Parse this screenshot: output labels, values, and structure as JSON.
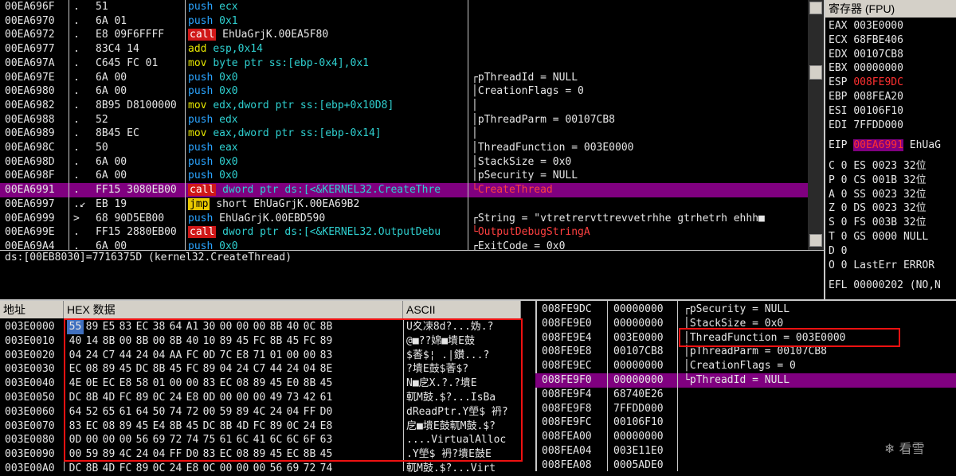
{
  "disasm": {
    "rows": [
      {
        "addr": "00EA696F",
        "mark": ".",
        "hex": "51",
        "op": "push",
        "arg": "ecx",
        "kind": "push",
        "comment": ""
      },
      {
        "addr": "00EA6970",
        "mark": ".",
        "hex": "6A 01",
        "op": "push",
        "arg": "0x1",
        "kind": "push",
        "comment": ""
      },
      {
        "addr": "00EA6972",
        "mark": ".",
        "hex": "E8 09F6FFFF",
        "op": "call",
        "arg": "EhUaGrjK.00EA5F80",
        "kind": "call",
        "comment": ""
      },
      {
        "addr": "00EA6977",
        "mark": ".",
        "hex": "83C4 14",
        "op": "add",
        "arg": "esp,0x14",
        "kind": "add",
        "comment": ""
      },
      {
        "addr": "00EA697A",
        "mark": ".",
        "hex": "C645 FC 01",
        "op": "mov",
        "arg": "byte ptr ss:[ebp-0x4],0x1",
        "kind": "mov",
        "comment": ""
      },
      {
        "addr": "00EA697E",
        "mark": ".",
        "hex": "6A 00",
        "op": "push",
        "arg": "0x0",
        "kind": "push",
        "comment": "┌pThreadId = NULL"
      },
      {
        "addr": "00EA6980",
        "mark": ".",
        "hex": "6A 00",
        "op": "push",
        "arg": "0x0",
        "kind": "push",
        "comment": "│CreationFlags = 0"
      },
      {
        "addr": "00EA6982",
        "mark": ".",
        "hex": "8B95 D8100000",
        "op": "mov",
        "arg": "edx,dword ptr ss:[ebp+0x10D8]",
        "kind": "mov",
        "comment": "│"
      },
      {
        "addr": "00EA6988",
        "mark": ".",
        "hex": "52",
        "op": "push",
        "arg": "edx",
        "kind": "push",
        "comment": "│pThreadParm = 00107CB8"
      },
      {
        "addr": "00EA6989",
        "mark": ".",
        "hex": "8B45 EC",
        "op": "mov",
        "arg": "eax,dword ptr ss:[ebp-0x14]",
        "kind": "mov",
        "comment": "│"
      },
      {
        "addr": "00EA698C",
        "mark": ".",
        "hex": "50",
        "op": "push",
        "arg": "eax",
        "kind": "push",
        "comment": "│ThreadFunction = 003E0000"
      },
      {
        "addr": "00EA698D",
        "mark": ".",
        "hex": "6A 00",
        "op": "push",
        "arg": "0x0",
        "kind": "push",
        "comment": "│StackSize = 0x0"
      },
      {
        "addr": "00EA698F",
        "mark": ".",
        "hex": "6A 00",
        "op": "push",
        "arg": "0x0",
        "kind": "push",
        "comment": "│pSecurity = NULL"
      },
      {
        "addr": "00EA6991",
        "mark": ".",
        "hex": "FF15 3080EB00",
        "op": "call",
        "arg": "dword ptr ds:[<&KERNEL32.CreateThre",
        "kind": "call",
        "comment": "└CreateThread",
        "sel": true
      },
      {
        "addr": "00EA6997",
        "mark": ".↙",
        "hex": "EB 19",
        "op": "jmp",
        "arg": "short EhUaGrjK.00EA69B2",
        "kind": "jmp",
        "comment": ""
      },
      {
        "addr": "00EA6999",
        "mark": ">",
        "hex": "68 90D5EB00",
        "op": "push",
        "arg": "EhUaGrjK.00EBD590",
        "kind": "push",
        "comment": "┌String = \"vtretrervttrevvetrhhe gtrhetrh ehhh■"
      },
      {
        "addr": "00EA699E",
        "mark": ".",
        "hex": "FF15 2880EB00",
        "op": "call",
        "arg": "dword ptr ds:[<&KERNEL32.OutputDebu",
        "kind": "call",
        "comment": "└OutputDebugStringA"
      },
      {
        "addr": "00EA69A4",
        "mark": ".",
        "hex": "6A 00",
        "op": "push",
        "arg": "0x0",
        "kind": "push",
        "comment": "┌ExitCode = 0x0"
      }
    ]
  },
  "info_line": "ds:[00EB8030]=7716375D (kernel32.CreateThread)",
  "registers": {
    "title": "寄存器 (FPU)",
    "lines": [
      {
        "name": "EAX",
        "value": "003E0000",
        "red": false
      },
      {
        "name": "ECX",
        "value": "68FBE406",
        "red": false
      },
      {
        "name": "EDX",
        "value": "00107CB8",
        "red": false
      },
      {
        "name": "EBX",
        "value": "00000000",
        "red": false
      },
      {
        "name": "ESP",
        "value": "008FE9DC",
        "red": true
      },
      {
        "name": "EBP",
        "value": "008FEA20",
        "red": false
      },
      {
        "name": "ESI",
        "value": "00106F10",
        "red": false
      },
      {
        "name": "EDI",
        "value": "7FFDD000",
        "red": false
      }
    ],
    "eip_name": "EIP",
    "eip_value": "00EA6991",
    "eip_sym": "EhUaG",
    "flags": [
      {
        "f": "C 0",
        "seg": "ES 0023",
        "bits": "32位"
      },
      {
        "f": "P 0",
        "seg": "CS 001B",
        "bits": "32位"
      },
      {
        "f": "A 0",
        "seg": "SS 0023",
        "bits": "32位"
      },
      {
        "f": "Z 0",
        "seg": "DS 0023",
        "bits": "32位"
      },
      {
        "f": "S 0",
        "seg": "FS 003B",
        "bits": "32位"
      },
      {
        "f": "T 0",
        "seg": "GS 0000",
        "bits": "NULL"
      },
      {
        "f": "D 0",
        "seg": "",
        "bits": ""
      },
      {
        "f": "O 0",
        "seg": "LastErr",
        "bits": "ERROR"
      }
    ],
    "efl": "EFL 00000202 (NO,N"
  },
  "dump": {
    "col_addr": "地址",
    "col_hex": "HEX 数据",
    "col_ascii": "ASCII",
    "rows": [
      {
        "addr": "003E0000",
        "bytes": [
          "55",
          "89",
          "E5",
          "83",
          "EC",
          "38",
          "64",
          "A1",
          "30",
          "00",
          "00",
          "00",
          "8B",
          "40",
          "0C",
          "8B"
        ],
        "ascii": "U夊凁8d?...妫.?"
      },
      {
        "addr": "003E0010",
        "bytes": [
          "40",
          "14",
          "8B",
          "00",
          "8B",
          "00",
          "8B",
          "40",
          "10",
          "89",
          "45",
          "FC",
          "8B",
          "45",
          "FC",
          "89"
        ],
        "ascii": "@■??婂■墤E鼓"
      },
      {
        "addr": "003E0020",
        "bytes": [
          "04",
          "24",
          "C7",
          "44",
          "24",
          "04",
          "AA",
          "FC",
          "0D",
          "7C",
          "E8",
          "71",
          "01",
          "00",
          "00",
          "83"
        ],
        "ascii": "$萫$¦ .|鑚...?"
      },
      {
        "addr": "003E0030",
        "bytes": [
          "EC",
          "08",
          "89",
          "45",
          "DC",
          "8B",
          "45",
          "FC",
          "89",
          "04",
          "24",
          "C7",
          "44",
          "24",
          "04",
          "8E"
        ],
        "ascii": "?墤E鼓$萫$?"
      },
      {
        "addr": "003E0040",
        "bytes": [
          "4E",
          "0E",
          "EC",
          "E8",
          "58",
          "01",
          "00",
          "00",
          "83",
          "EC",
          "08",
          "89",
          "45",
          "E0",
          "8B",
          "45"
        ],
        "ascii": "N■戹X.?.?墤E"
      },
      {
        "addr": "003E0050",
        "bytes": [
          "DC",
          "8B",
          "4D",
          "FC",
          "89",
          "0C",
          "24",
          "E8",
          "0D",
          "00",
          "00",
          "00",
          "49",
          "73",
          "42",
          "61"
        ],
        "ascii": "軏M鼓.$?...IsBa"
      },
      {
        "addr": "003E0060",
        "bytes": [
          "64",
          "52",
          "65",
          "61",
          "64",
          "50",
          "74",
          "72",
          "00",
          "59",
          "89",
          "4C",
          "24",
          "04",
          "FF",
          "D0"
        ],
        "ascii": "dReadPtr.Y塋$ 袇?"
      },
      {
        "addr": "003E0070",
        "bytes": [
          "83",
          "EC",
          "08",
          "89",
          "45",
          "E4",
          "8B",
          "45",
          "DC",
          "8B",
          "4D",
          "FC",
          "89",
          "0C",
          "24",
          "E8"
        ],
        "ascii": "戹■墤E鼓軏M鼓.$?"
      },
      {
        "addr": "003E0080",
        "bytes": [
          "0D",
          "00",
          "00",
          "00",
          "56",
          "69",
          "72",
          "74",
          "75",
          "61",
          "6C",
          "41",
          "6C",
          "6C",
          "6F",
          "63"
        ],
        "ascii": "....VirtualAlloc"
      },
      {
        "addr": "003E0090",
        "bytes": [
          "00",
          "59",
          "89",
          "4C",
          "24",
          "04",
          "FF",
          "D0",
          "83",
          "EC",
          "08",
          "89",
          "45",
          "EC",
          "8B",
          "45"
        ],
        "ascii": ".Y塋$ 袇?墤E鼓E"
      },
      {
        "addr": "003E00A0",
        "bytes": [
          "DC",
          "8B",
          "4D",
          "FC",
          "89",
          "0C",
          "24",
          "E8",
          "0C",
          "00",
          "00",
          "00",
          "56",
          "69",
          "72",
          "74"
        ],
        "ascii": "軏M鼓.$?...Virt"
      }
    ]
  },
  "stack": {
    "rows": [
      {
        "addr": "008FE9DC",
        "val": "00000000",
        "cmt": "┌pSecurity = NULL"
      },
      {
        "addr": "008FE9E0",
        "val": "00000000",
        "cmt": "│StackSize = 0x0"
      },
      {
        "addr": "008FE9E4",
        "val": "003E0000",
        "cmt": "│ThreadFunction = 003E0000"
      },
      {
        "addr": "008FE9E8",
        "val": "00107CB8",
        "cmt": "│pThreadParm = 00107CB8"
      },
      {
        "addr": "008FE9EC",
        "val": "00000000",
        "cmt": "│CreationFlags = 0"
      },
      {
        "addr": "008FE9F0",
        "val": "00000000",
        "cmt": "└pThreadId = NULL",
        "sel": true
      },
      {
        "addr": "008FE9F4",
        "val": "68740E26",
        "cmt": ""
      },
      {
        "addr": "008FE9F8",
        "val": "7FFDD000",
        "cmt": ""
      },
      {
        "addr": "008FE9FC",
        "val": "00106F10",
        "cmt": ""
      },
      {
        "addr": "008FEA00",
        "val": "00000000",
        "cmt": ""
      },
      {
        "addr": "008FEA04",
        "val": "003E11E0",
        "cmt": ""
      },
      {
        "addr": "008FEA08",
        "val": "0005ADE0",
        "cmt": ""
      }
    ]
  },
  "watermark": "看雪",
  "colors": {
    "selection": "#800080",
    "push": "#2aa4ff",
    "call_bg": "#d01818",
    "jmp_bg": "#e8c800",
    "mov": "#e6e600",
    "highlight_box": "#e11111"
  }
}
